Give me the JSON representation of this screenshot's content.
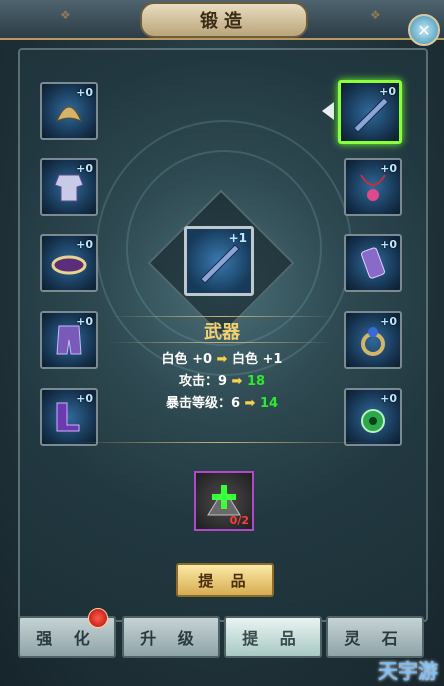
{
  "window": {
    "title": "锻造"
  },
  "equipment_left": [
    {
      "name": "helmet-icon",
      "level": "+0"
    },
    {
      "name": "armor-icon",
      "level": "+0"
    },
    {
      "name": "belt-icon",
      "level": "+0"
    },
    {
      "name": "leg-guard-icon",
      "level": "+0"
    },
    {
      "name": "boots-icon",
      "level": "+0"
    }
  ],
  "equipment_right": [
    {
      "name": "weapon-icon",
      "level": "+0"
    },
    {
      "name": "necklace-icon",
      "level": "+0"
    },
    {
      "name": "bracer-icon",
      "level": "+0"
    },
    {
      "name": "ring-icon",
      "level": "+0"
    },
    {
      "name": "jade-pendant-icon",
      "level": "+0"
    }
  ],
  "selected_item": {
    "level": "+1",
    "name": "武器",
    "quality_line": {
      "from": "白色 +0",
      "to": "白色 +1"
    },
    "attack_line": {
      "label": "攻击：9",
      "to": "18"
    },
    "crit_line": {
      "label": "暴击等级：6",
      "to": "14"
    }
  },
  "material": {
    "count": "0/2"
  },
  "action_button": "提 品",
  "tabs": [
    "强 化",
    "升 级",
    "提 品",
    "灵 石"
  ],
  "colors": {
    "highlight": "#8bff3c",
    "increase": "#2eea2e",
    "arrow": "#f7d24a"
  },
  "watermark": "天宇游"
}
